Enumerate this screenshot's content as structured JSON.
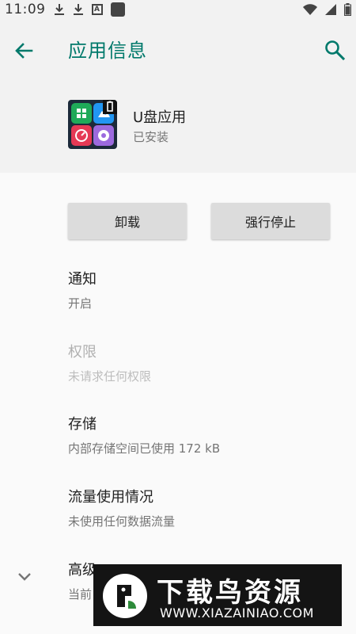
{
  "status_bar": {
    "time": "11:09",
    "icons": [
      "download-icon",
      "download-icon",
      "a-box-icon",
      "square-icon",
      "wifi-icon",
      "signal-icon",
      "battery-icon"
    ]
  },
  "app_bar": {
    "title": "应用信息",
    "back_icon": "arrow-back-icon",
    "search_icon": "search-icon",
    "accent_color": "#00796b"
  },
  "app": {
    "name": "U盘应用",
    "status": "已安装"
  },
  "buttons": {
    "uninstall": "卸载",
    "force_stop": "强行停止"
  },
  "preferences": [
    {
      "title": "通知",
      "summary": "开启",
      "enabled": true
    },
    {
      "title": "权限",
      "summary": "未请求任何权限",
      "enabled": false
    },
    {
      "title": "存储",
      "summary": "内部存储空间已使用 172 kB",
      "enabled": true
    },
    {
      "title": "流量使用情况",
      "summary": "未使用任何数据流量",
      "enabled": true
    },
    {
      "title": "高级",
      "summary": "当前",
      "enabled": true
    }
  ],
  "watermark": {
    "title": "下载鸟资源",
    "url": "WWW.XIAZAINIAO.COM"
  }
}
